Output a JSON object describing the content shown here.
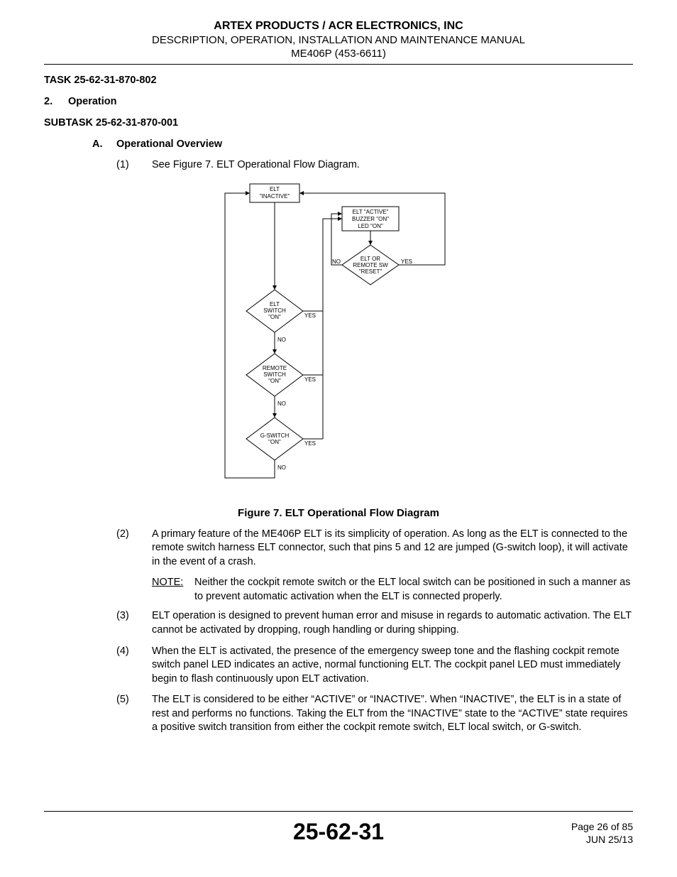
{
  "header": {
    "company": "ARTEX PRODUCTS / ACR ELECTRONICS, INC",
    "description": "DESCRIPTION, OPERATION, INSTALLATION AND MAINTENANCE MANUAL",
    "model": "ME406P (453-6611)"
  },
  "task": "TASK 25-62-31-870-802",
  "section": {
    "number": "2.",
    "title": "Operation"
  },
  "subtask": "SUBTASK 25-62-31-870-001",
  "sub": {
    "letter": "A.",
    "title": "Operational Overview"
  },
  "paras": {
    "p1": {
      "n": "(1)",
      "t": "See Figure 7. ELT Operational Flow Diagram."
    },
    "p2": {
      "n": "(2)",
      "t": "A primary feature of the ME406P ELT is its simplicity of operation. As long as the ELT is connected to the remote switch harness ELT connector, such that pins 5 and 12 are jumped (G-switch loop), it will activate in the event of a crash."
    },
    "note": {
      "label": "NOTE",
      "colon": ":",
      "t": "Neither the cockpit remote switch or the ELT local switch can be positioned in such a manner as to prevent automatic activation when the ELT is connected properly."
    },
    "p3": {
      "n": "(3)",
      "t": "ELT operation is designed to prevent human error and misuse in regards to automatic activation. The ELT cannot be activated by dropping, rough handling or during shipping."
    },
    "p4": {
      "n": "(4)",
      "t": "When the ELT is activated, the presence of the emergency sweep tone and the flashing cockpit remote switch panel LED indicates an active, normal functioning ELT. The cockpit panel LED must immediately begin to flash continuously upon ELT activation."
    },
    "p5": {
      "n": "(5)",
      "t": "The ELT is considered to be either “ACTIVE” or “INACTIVE”. When “INACTIVE”, the ELT is in a state of rest and performs no functions. Taking the ELT from the “INACTIVE” state to the “ACTIVE” state requires a positive switch transition from either the cockpit remote switch, ELT local switch, or G-switch."
    }
  },
  "figure_caption": "Figure 7.  ELT Operational Flow Diagram",
  "flow": {
    "inactive": {
      "l1": "ELT",
      "l2": "\"INACTIVE\""
    },
    "active": {
      "l1": "ELT \"ACTIVE\"",
      "l2": "BUZZER \"ON\"",
      "l3": "LED \"ON\""
    },
    "reset": {
      "l1": "ELT OR",
      "l2": "REMOTE SW",
      "l3": "\"RESET\""
    },
    "eltsw": {
      "l1": "ELT",
      "l2": "SWITCH",
      "l3": "\"ON\""
    },
    "remsw": {
      "l1": "REMOTE",
      "l2": "SWITCH",
      "l3": "\"ON\""
    },
    "gsw": {
      "l1": "G-SWITCH",
      "l2": "\"ON\""
    },
    "labels": {
      "yes": "YES",
      "no": "NO"
    }
  },
  "footer": {
    "chapter": "25-62-31",
    "page_of": "Page 26 of 85",
    "date": "JUN 25/13"
  }
}
